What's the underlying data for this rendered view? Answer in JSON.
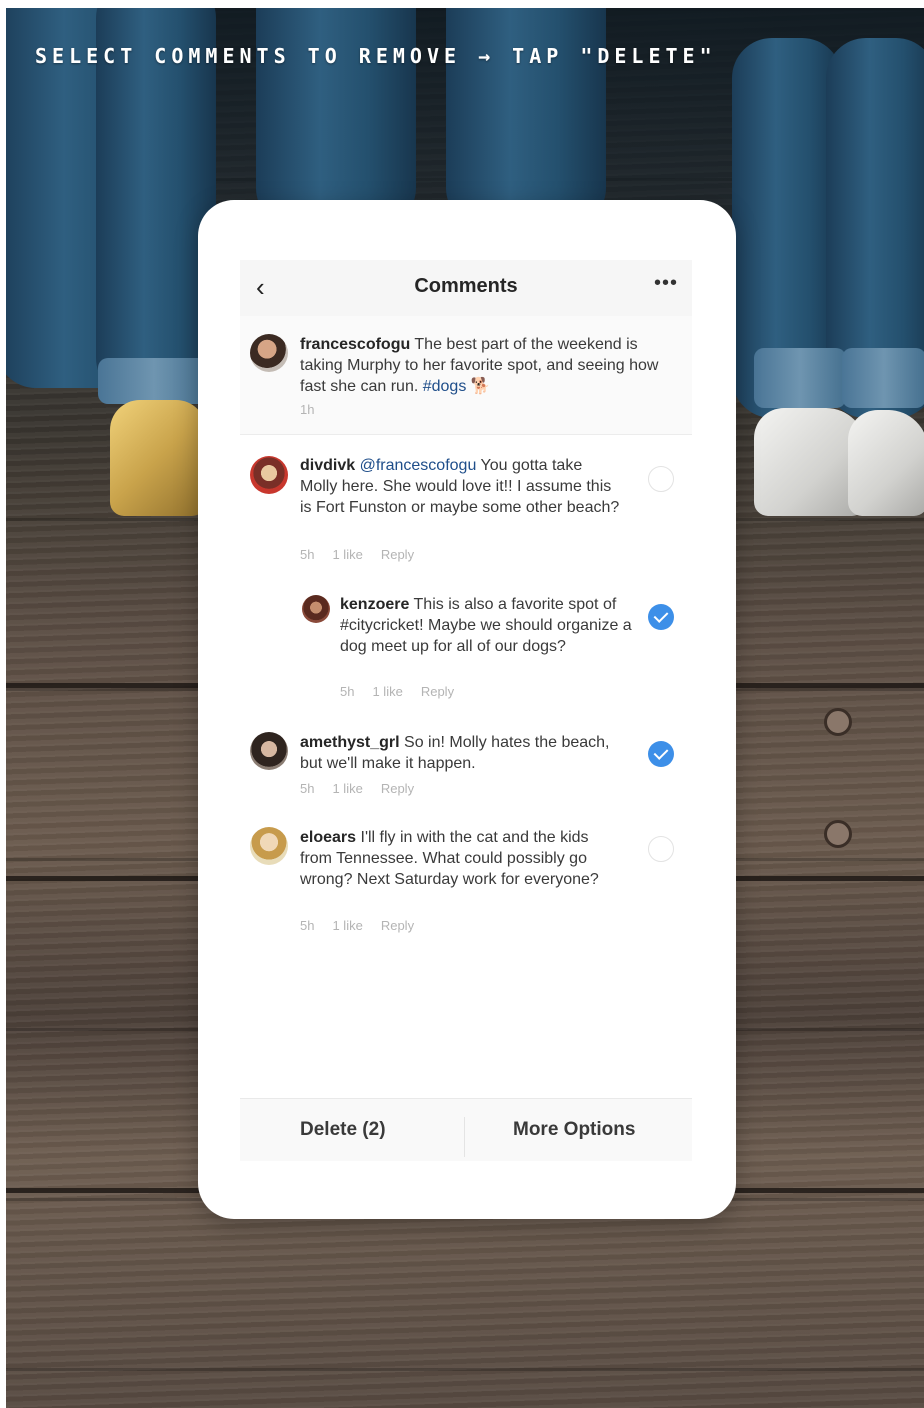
{
  "headline": "SELECT COMMENTS TO REMOVE → TAP \"DELETE\"",
  "nav": {
    "title": "Comments",
    "back_icon": "chevron-left-icon",
    "more_icon": "ellipsis-icon"
  },
  "caption": {
    "username": "francescofogu",
    "text_before": " The best part of the weekend is taking Murphy to her favorite spot, and seeing how fast she can run. ",
    "hashtag": "#dogs",
    "emoji": "🐕",
    "time": "1h"
  },
  "comments": [
    {
      "username": "divdivk",
      "mention": "@francescofogu",
      "text": " You gotta take Molly here. She would love it!! I assume this is Fort Funston or maybe some other beach?",
      "time": "5h",
      "likes": "1 like",
      "reply": "Reply",
      "selected": false
    },
    {
      "username": "kenzoere",
      "text": " This is also a favorite spot of #citycricket! Maybe we should organize a dog meet up for all of our dogs?",
      "time": "5h",
      "likes": "1 like",
      "reply": "Reply",
      "selected": true
    },
    {
      "username": "amethyst_grl",
      "text": " So in! Molly hates the beach, but we'll make it happen.",
      "time": "5h",
      "likes": "1 like",
      "reply": "Reply",
      "selected": true
    },
    {
      "username": "eloears",
      "text": " I'll fly in with the cat and the kids from Tennessee. What could possibly go wrong? Next Saturday work for everyone?",
      "time": "5h",
      "likes": "1 like",
      "reply": "Reply",
      "selected": false
    }
  ],
  "toolbar": {
    "delete_label": "Delete (2)",
    "more_label": "More Options"
  },
  "colors": {
    "accent": "#3d8fe8",
    "link": "#1f4e8a"
  }
}
